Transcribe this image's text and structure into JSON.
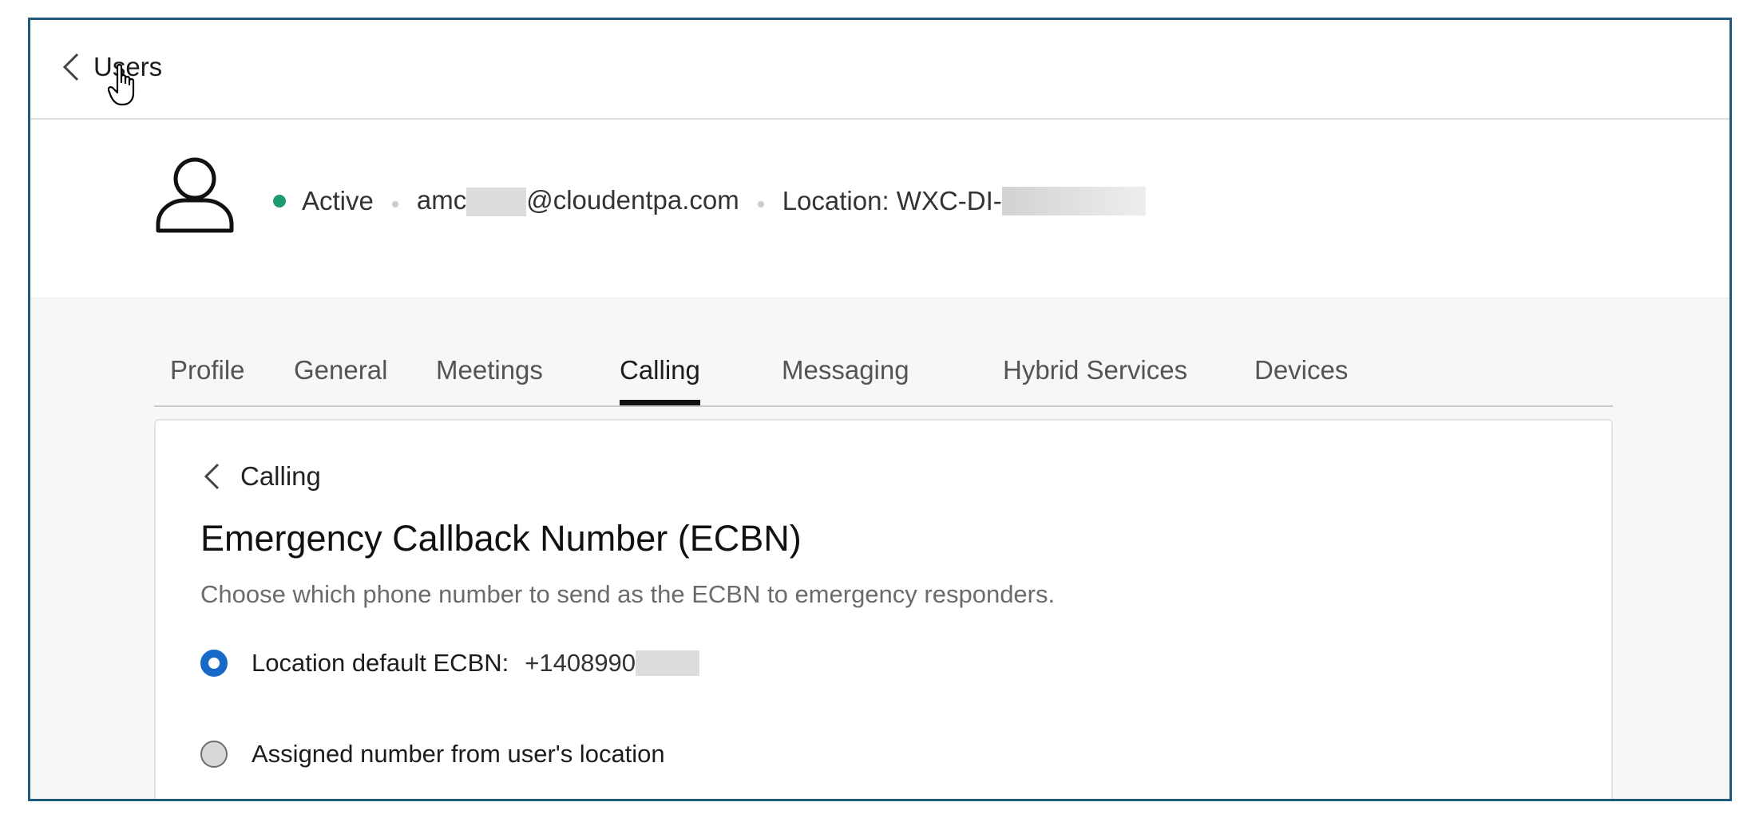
{
  "nav": {
    "back_label": "Users"
  },
  "user": {
    "status": "Active",
    "email_prefix": "amc",
    "email_domain": "@cloudentpa.com",
    "location": "Location: WXC-DI-",
    "status_color": "#1d9c6d"
  },
  "tabs": [
    {
      "label": "Profile"
    },
    {
      "label": "General"
    },
    {
      "label": "Meetings"
    },
    {
      "label": "Calling",
      "active": true
    },
    {
      "label": "Messaging"
    },
    {
      "label": "Hybrid Services"
    },
    {
      "label": "Devices"
    }
  ],
  "card": {
    "back_label": "Calling",
    "title": "Emergency Callback Number (ECBN)",
    "description": "Choose which phone number to send as the ECBN to emergency responders.",
    "options": [
      {
        "label": "Location default ECBN:",
        "number": "+1408990",
        "selected": true
      },
      {
        "label": "Assigned number from user's location",
        "selected": false
      }
    ]
  },
  "colors": {
    "frame_border": "#1f5a7f",
    "radio_selected": "#1769c7",
    "accent": "#111111"
  },
  "icons": [
    "chevron-left-icon",
    "hand-cursor-icon",
    "user-avatar-icon"
  ]
}
